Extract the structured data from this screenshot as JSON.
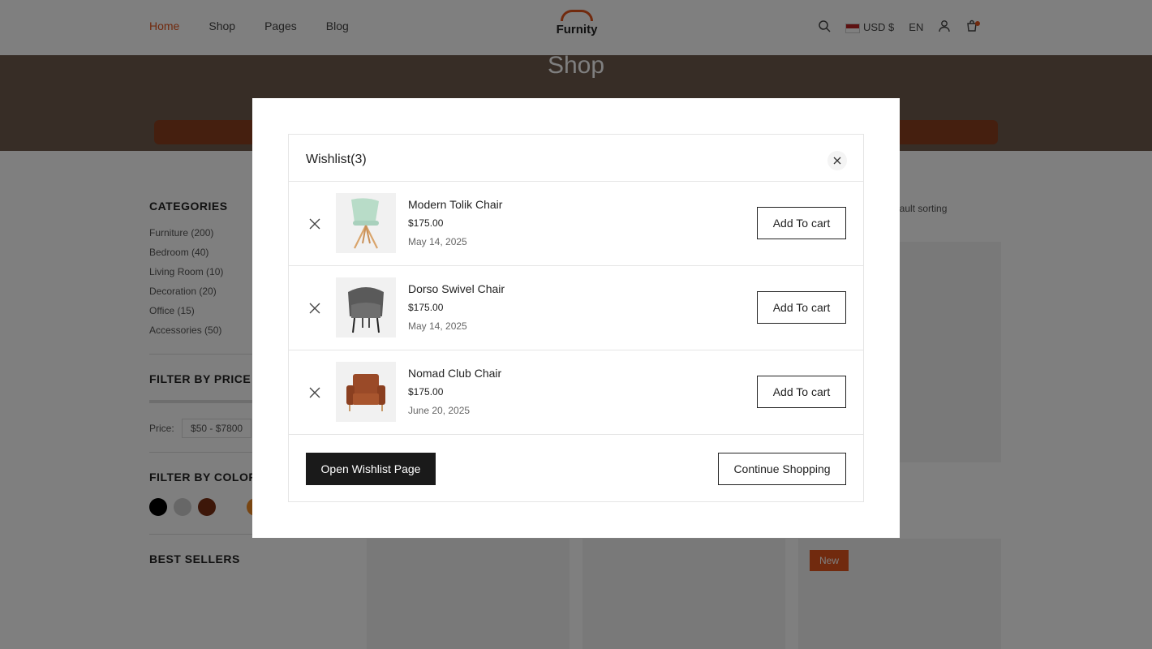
{
  "background": {
    "nav": [
      "Home",
      "Shop",
      "Pages",
      "Blog"
    ],
    "logo_text": "Furnity",
    "currency": "USD $",
    "language": "EN",
    "hero_title": "Shop",
    "sidebar": {
      "categories_title": "CATEGORIES",
      "categories": [
        "Furniture (200)",
        "Bedroom (40)",
        "Living Room (10)",
        "Decoration (20)",
        "Office (15)",
        "Accessories (50)"
      ],
      "price_title": "FILTER BY PRICE",
      "price_label": "Price:",
      "price_range": "$50 - $7800",
      "color_title": "FILTER BY COLOR",
      "best_title": "BEST SELLERS"
    },
    "sort_label": "Default sorting",
    "badge": "New",
    "swatch_colors": [
      "#000000",
      "#cfcfcf",
      "#7a2e12",
      "#ffffff",
      "#f08a24",
      "#e9c08a",
      "#e9d6c2"
    ]
  },
  "wishlist": {
    "title": "Wishlist(3)",
    "items": [
      {
        "name": "Modern Tolik Chair",
        "price": "$175.00",
        "date": "May 14, 2025",
        "action": "Add To cart",
        "image": "mint-chair"
      },
      {
        "name": "Dorso Swivel Chair",
        "price": "$175.00",
        "date": "May 14, 2025",
        "action": "Add To cart",
        "image": "grey-armchair"
      },
      {
        "name": "Nomad Club Chair",
        "price": "$175.00",
        "date": "June 20, 2025",
        "action": "Add To cart",
        "image": "brown-leather-chair"
      }
    ],
    "open_label": "Open Wishlist Page",
    "continue_label": "Continue Shopping"
  },
  "colors": {
    "accent": "#e2541d",
    "dark_button": "#1a1a1a",
    "overlay": "rgba(0,0,0,0.5)"
  }
}
